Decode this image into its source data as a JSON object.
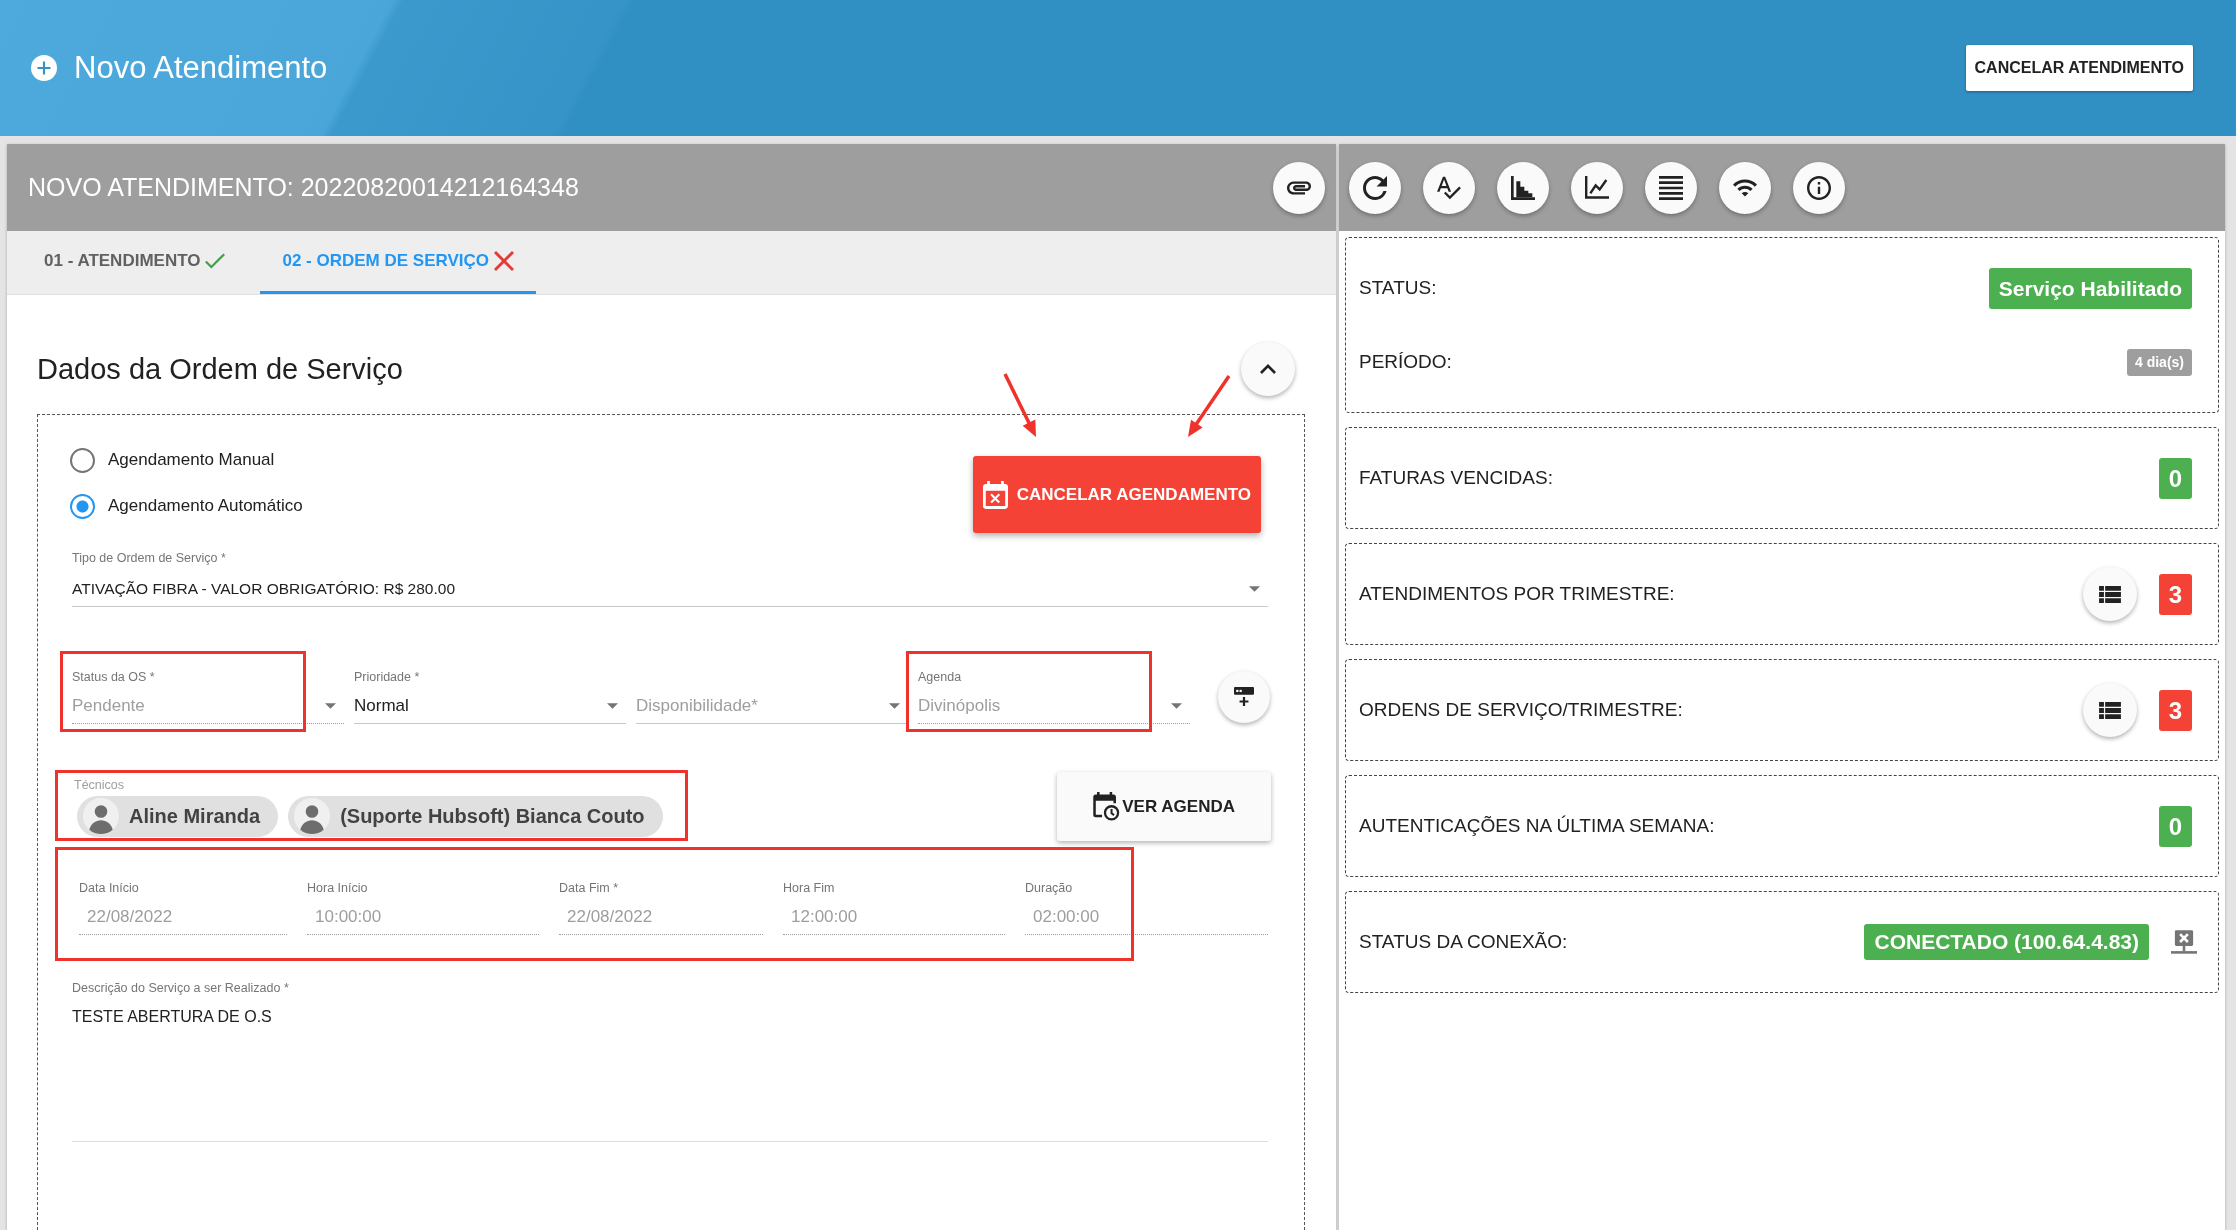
{
  "header": {
    "title": "Novo Atendimento",
    "cancel_button": "CANCELAR ATENDIMENTO"
  },
  "record": {
    "title": "NOVO ATENDIMENTO: 20220820014212164348",
    "tabs": [
      {
        "label": "01 - ATENDIMENTO",
        "selected": false,
        "valid": true
      },
      {
        "label": "02 - ORDEM DE SERVIÇO",
        "selected": true,
        "valid": false
      }
    ]
  },
  "service_order": {
    "title": "Dados da Ordem de Serviço",
    "expanded": true,
    "scheduling": [
      {
        "label": "Agendamento Manual",
        "selected": false
      },
      {
        "label": "Agendamento Automático",
        "selected": true
      }
    ],
    "cancel_schedule_button": {
      "label": "CANCELAR AGENDAMENTO",
      "annotated": true
    },
    "service_type": {
      "label": "Tipo de Ordem de Serviço *",
      "value": "ATIVAÇÃO FIBRA - VALOR OBRIGATÓRIO: R$ 280.00"
    },
    "selects": [
      {
        "label": "Status da OS *",
        "value": "Pendente",
        "disabled": true,
        "highlighted": true
      },
      {
        "label": "Prioridade *",
        "value": "Normal",
        "disabled": false,
        "highlighted": false
      },
      {
        "placeholder": "Disponibilidade*",
        "disabled": false,
        "highlighted": false
      },
      {
        "label": "Agenda",
        "value": "Divinópolis",
        "disabled": true,
        "highlighted": true
      }
    ],
    "technicians": {
      "label": "Técnicos",
      "highlighted": true,
      "names": [
        "Aline Miranda",
        "(Suporte Hubsoft) Bianca Couto"
      ]
    },
    "view_schedule_button": "VER AGENDA",
    "schedule": {
      "highlighted": true,
      "fields": [
        {
          "label": "Data Início",
          "value": "22/08/2022",
          "disabled": true
        },
        {
          "label": "Hora Início",
          "value": "10:00:00",
          "disabled": true
        },
        {
          "label": "Data Fim *",
          "value": "22/08/2022",
          "disabled": true
        },
        {
          "label": "Hora Fim",
          "value": "12:00:00",
          "disabled": true
        },
        {
          "label": "Duração",
          "value": "02:00:00",
          "disabled": true
        }
      ]
    },
    "description": {
      "label": "Descrição do Serviço a ser Realizado *",
      "value": "TESTE ABERTURA DE O.S"
    }
  },
  "summary": {
    "cards": [
      {
        "rows": [
          {
            "kind": "status",
            "label": "STATUS:",
            "badge": "Serviço Habilitado",
            "color": "#4caf50"
          },
          {
            "kind": "period",
            "label": "PERÍODO:",
            "badge": "4 dia(s)",
            "color": "#9e9e9e"
          }
        ]
      },
      {
        "rows": [
          {
            "kind": "count",
            "label": "FATURAS VENCIDAS:",
            "badge": "0",
            "color": "#4caf50"
          }
        ]
      },
      {
        "rows": [
          {
            "kind": "count_list",
            "label": "ATENDIMENTOS POR TRIMESTRE:",
            "badge": "3",
            "color": "#f44336"
          }
        ]
      },
      {
        "rows": [
          {
            "kind": "count_list",
            "label": "ORDENS DE SERVIÇO/TRIMESTRE:",
            "badge": "3",
            "color": "#f44336"
          }
        ]
      },
      {
        "rows": [
          {
            "kind": "count",
            "label": "AUTENTICAÇÕES NA ÚLTIMA SEMANA:",
            "badge": "0",
            "color": "#4caf50"
          }
        ]
      },
      {
        "rows": [
          {
            "kind": "connection",
            "label": "STATUS DA CONEXÃO:",
            "badge": "CONECTADO (100.64.4.83)",
            "color": "#4caf50"
          }
        ]
      }
    ]
  }
}
